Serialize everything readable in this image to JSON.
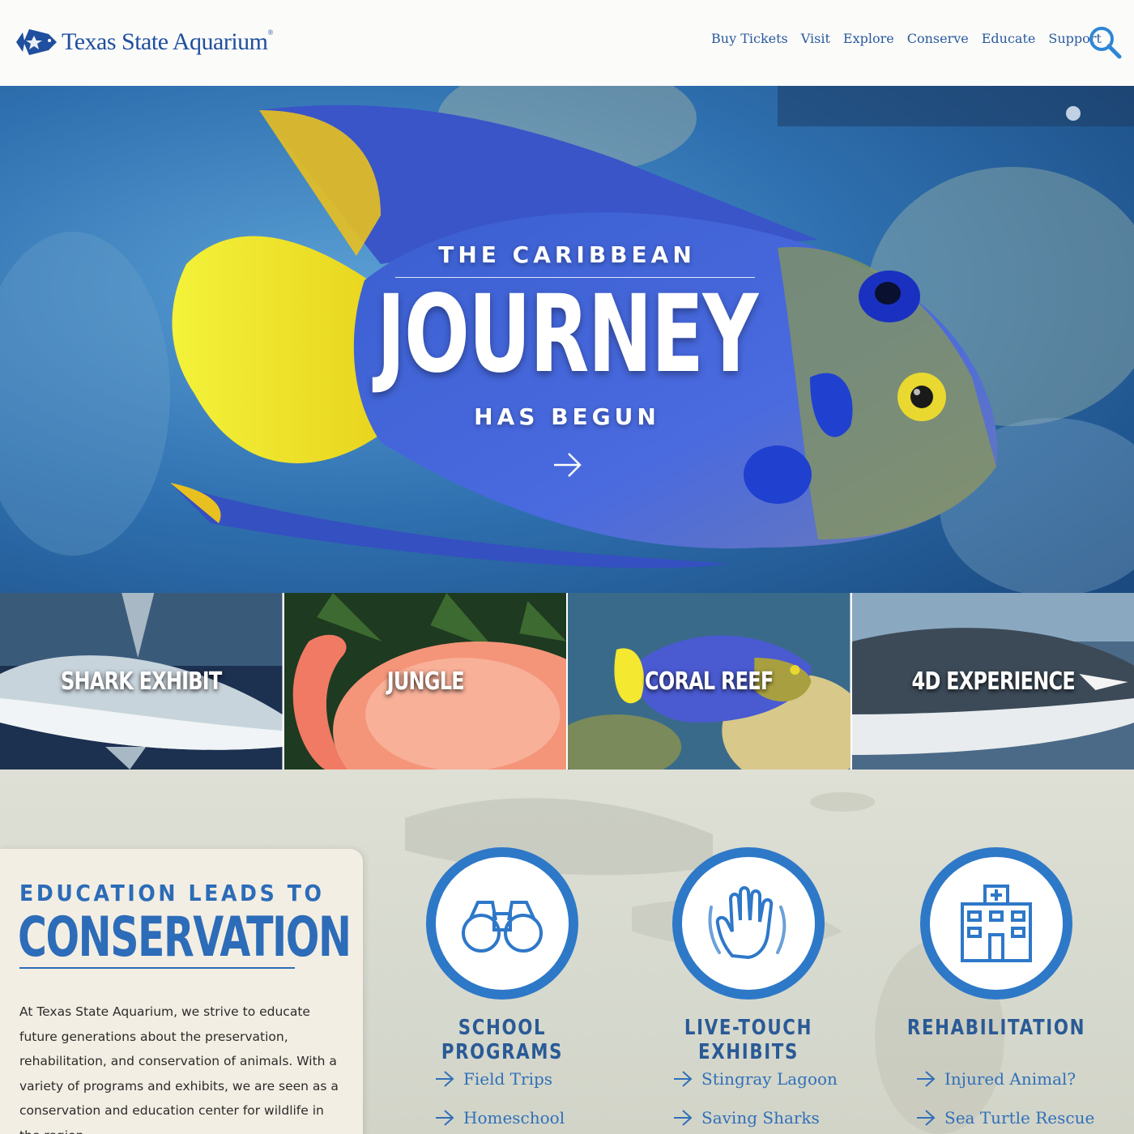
{
  "brand": {
    "name": "Texas State Aquarium",
    "reg": "®",
    "color": "#1f4f9e"
  },
  "nav": {
    "items": [
      "Buy Tickets",
      "Visit",
      "Explore",
      "Conserve",
      "Educate",
      "Support"
    ],
    "search_icon": "search-icon"
  },
  "hero": {
    "kicker": "THE CARIBBEAN",
    "headline": "JOURNEY",
    "subline": "HAS BEGUN",
    "arrow_icon": "arrow-right-icon"
  },
  "tiles": [
    {
      "label": "SHARK EXHIBIT"
    },
    {
      "label": "JUNGLE"
    },
    {
      "label": "CORAL REEF"
    },
    {
      "label": "4D EXPERIENCE"
    }
  ],
  "education": {
    "kicker": "EDUCATION LEADS TO",
    "title": "CONSERVATION",
    "body": "At Texas State Aquarium, we strive to educate future generations about the preservation, rehabilitation, and conservation of animals. With a variety of programs and exhibits, we are seen as a conservation and education center for wildlife in the region."
  },
  "programs": [
    {
      "title": "SCHOOL PROGRAMS",
      "icon": "binoculars-icon",
      "links": [
        "Field Trips",
        "Homeschool"
      ]
    },
    {
      "title": "LIVE-TOUCH EXHIBITS",
      "icon": "hand-icon",
      "links": [
        "Stingray Lagoon",
        "Saving Sharks"
      ]
    },
    {
      "title": "REHABILITATION",
      "icon": "hospital-icon",
      "links": [
        "Injured Animal?",
        "Sea Turtle Rescue"
      ]
    }
  ],
  "colors": {
    "accent": "#2e78c8",
    "heading_blue": "#2c6cb8",
    "nav_blue": "#2a5a9c"
  }
}
